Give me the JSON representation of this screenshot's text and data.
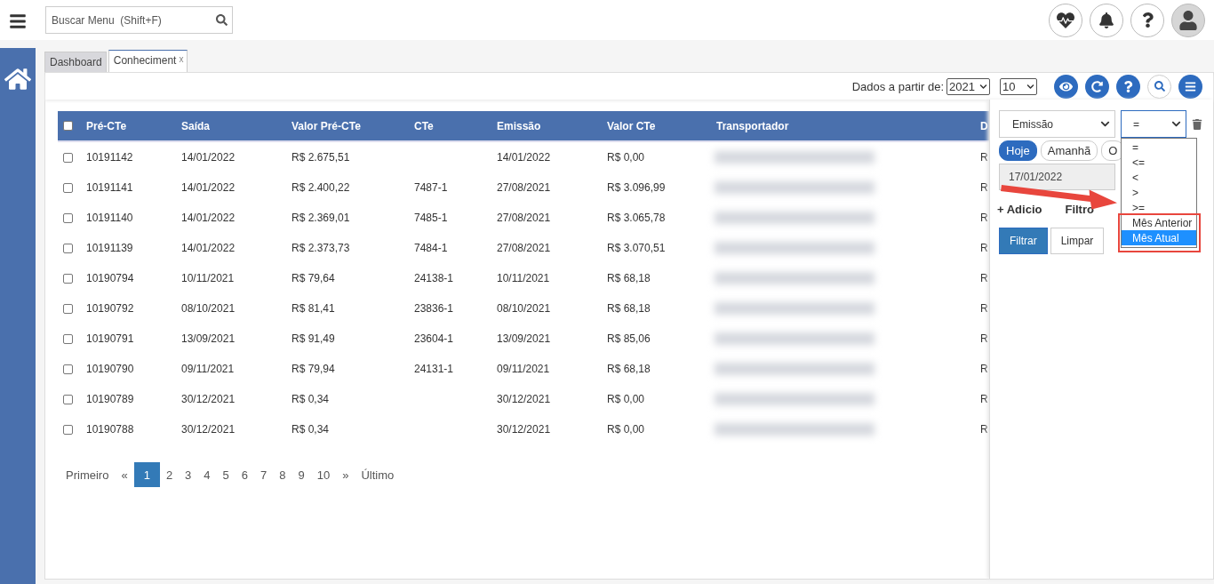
{
  "topbar": {
    "search": {
      "placeholder": "Buscar Menu  (Shift+F)"
    }
  },
  "tabs": [
    {
      "label": "Dashboard",
      "selected": false
    },
    {
      "label": "Conheciment",
      "selected": true,
      "close": "x"
    }
  ],
  "toolbar": {
    "since_label": "Dados a partir de:",
    "year": "2021",
    "page_size": "10"
  },
  "table": {
    "all_checked": false,
    "columns": [
      "Pré-CTe",
      "Saída",
      "Valor Pré-CTe",
      "CTe",
      "Emissão",
      "Valor CTe",
      "Transportador",
      "D"
    ],
    "rows": [
      {
        "checked": false,
        "cells": [
          "10191142",
          "14/01/2022",
          "R$ 2.675,51",
          "",
          "14/01/2022",
          "R$ 0,00",
          "R"
        ]
      },
      {
        "checked": false,
        "cells": [
          "10191141",
          "14/01/2022",
          "R$ 2.400,22",
          "7487-1",
          "27/08/2021",
          "R$ 3.096,99",
          "R"
        ]
      },
      {
        "checked": false,
        "cells": [
          "10191140",
          "14/01/2022",
          "R$ 2.369,01",
          "7485-1",
          "27/08/2021",
          "R$ 3.065,78",
          "R"
        ]
      },
      {
        "checked": false,
        "cells": [
          "10191139",
          "14/01/2022",
          "R$ 2.373,73",
          "7484-1",
          "27/08/2021",
          "R$ 3.070,51",
          "R"
        ]
      },
      {
        "checked": false,
        "cells": [
          "10190794",
          "10/11/2021",
          "R$ 79,64",
          "24138-1",
          "10/11/2021",
          "R$ 68,18",
          "R"
        ]
      },
      {
        "checked": false,
        "cells": [
          "10190792",
          "08/10/2021",
          "R$ 81,41",
          "23836-1",
          "08/10/2021",
          "R$ 68,18",
          "R"
        ]
      },
      {
        "checked": false,
        "cells": [
          "10190791",
          "13/09/2021",
          "R$ 91,49",
          "23604-1",
          "13/09/2021",
          "R$ 85,06",
          "R"
        ]
      },
      {
        "checked": false,
        "cells": [
          "10190790",
          "09/11/2021",
          "R$ 79,94",
          "24131-1",
          "09/11/2021",
          "R$ 68,18",
          "R"
        ]
      },
      {
        "checked": false,
        "cells": [
          "10190789",
          "30/12/2021",
          "R$ 0,34",
          "",
          "30/12/2021",
          "R$ 0,00",
          "R"
        ]
      },
      {
        "checked": false,
        "cells": [
          "10190788",
          "30/12/2021",
          "R$ 0,34",
          "",
          "30/12/2021",
          "R$ 0,00",
          "R"
        ]
      }
    ]
  },
  "pagination": {
    "first": "Primeiro",
    "prev": "«",
    "next": "»",
    "last": "Último",
    "pages": [
      {
        "label": "1",
        "selected": true
      },
      {
        "label": "2",
        "selected": false
      },
      {
        "label": "3",
        "selected": false
      },
      {
        "label": "4",
        "selected": false
      },
      {
        "label": "5",
        "selected": false
      },
      {
        "label": "6",
        "selected": false
      },
      {
        "label": "7",
        "selected": false
      },
      {
        "label": "8",
        "selected": false
      },
      {
        "label": "9",
        "selected": false
      },
      {
        "label": "10",
        "selected": false
      }
    ]
  },
  "filter_panel": {
    "field": "Emissão",
    "operator": "=",
    "chips": [
      {
        "label": "Hoje",
        "selected": true
      },
      {
        "label": "Amanhã",
        "selected": false
      },
      {
        "label": "O",
        "selected": false
      }
    ],
    "date": "17/01/2022",
    "add_filter": [
      "+ Adicio",
      "Filtro"
    ],
    "operator_options": [
      {
        "label": "=",
        "selected": false
      },
      {
        "label": "<=",
        "selected": false
      },
      {
        "label": "<",
        "selected": false
      },
      {
        "label": ">",
        "selected": false
      },
      {
        "label": ">=",
        "selected": false
      },
      {
        "label": "Mês Anterior",
        "selected": false
      },
      {
        "label": "Mês Atual",
        "selected": true
      }
    ],
    "buttons": [
      {
        "label": "Filtrar",
        "kind": "primary"
      },
      {
        "label": "Limpar",
        "kind": "default"
      }
    ]
  }
}
